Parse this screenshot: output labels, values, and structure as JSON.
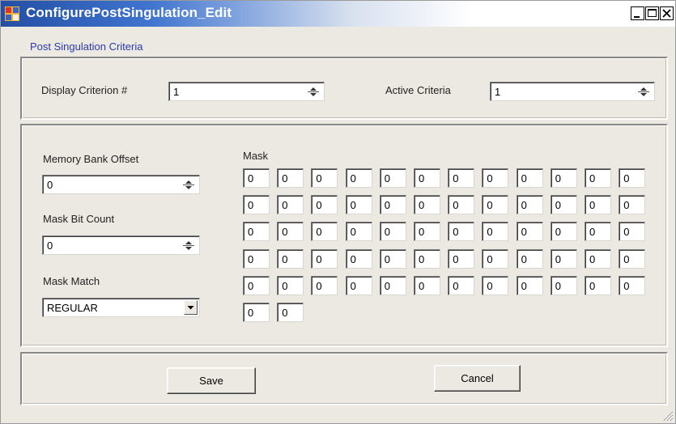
{
  "window": {
    "title": "ConfigurePostSingulation_Edit",
    "controls": [
      "minimize-icon",
      "maximize-icon",
      "close-icon"
    ]
  },
  "section_title": "Post Singulation Criteria",
  "criteria": {
    "display_label": "Display Criterion #",
    "display_value": "1",
    "active_label": "Active Criteria",
    "active_value": "1"
  },
  "memory": {
    "bank_offset_label": "Memory Bank Offset",
    "bank_offset_value": "0",
    "bit_count_label": "Mask Bit Count",
    "bit_count_value": "0",
    "match_label": "Mask Match",
    "match_value": "REGULAR"
  },
  "mask": {
    "label": "Mask",
    "cells": [
      "0",
      "0",
      "0",
      "0",
      "0",
      "0",
      "0",
      "0",
      "0",
      "0",
      "0",
      "0",
      "0",
      "0",
      "0",
      "0",
      "0",
      "0",
      "0",
      "0",
      "0",
      "0",
      "0",
      "0",
      "0",
      "0",
      "0",
      "0",
      "0",
      "0",
      "0",
      "0",
      "0",
      "0",
      "0",
      "0",
      "0",
      "0",
      "0",
      "0",
      "0",
      "0",
      "0",
      "0",
      "0",
      "0",
      "0",
      "0",
      "0",
      "0",
      "0",
      "0",
      "0",
      "0",
      "0",
      "0",
      "0",
      "0",
      "0",
      "0",
      "0",
      "0"
    ]
  },
  "buttons": {
    "save": "Save",
    "cancel": "Cancel"
  }
}
